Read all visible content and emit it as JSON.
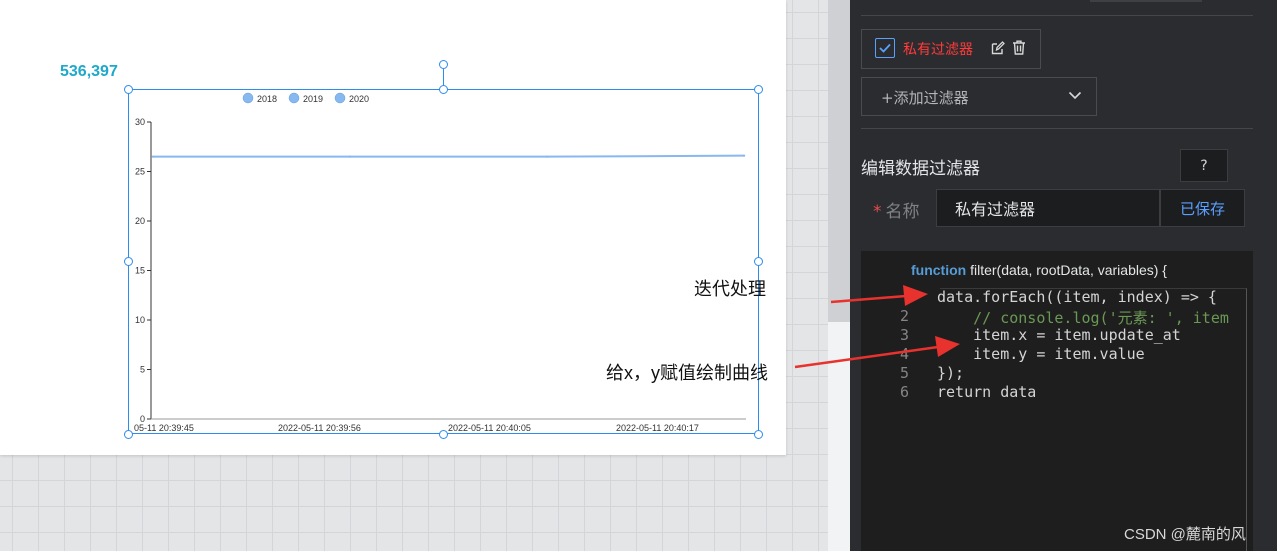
{
  "canvas": {
    "counter_value": "536,397",
    "chart_legend": [
      "2018",
      "2019",
      "2020"
    ]
  },
  "chart_data": {
    "type": "line",
    "x": [
      "05-11 20:39:45",
      "2022-05-11 20:39:56",
      "2022-05-11 20:40:05",
      "2022-05-11 20:40:17"
    ],
    "series": [
      {
        "name": "2018",
        "values": [
          26.5,
          26.5,
          26.5,
          26.6
        ]
      }
    ],
    "y_ticks": [
      0,
      5,
      10,
      15,
      20,
      25,
      30
    ],
    "ylim": [
      0,
      30
    ],
    "legend": [
      "2018",
      "2019",
      "2020"
    ],
    "legend_position": "top-left",
    "grid": false,
    "line_color": "#88b8f0"
  },
  "annotations": {
    "iterate": "迭代处理",
    "assign": "给x，y赋值绘制曲线"
  },
  "panel": {
    "filter_chip_label": "私有过滤器",
    "add_filter_label": "+添加过滤器",
    "edit_title": "编辑数据过滤器",
    "help_label": "?",
    "name_required_mark": "*",
    "name_label": "名称",
    "name_value": "私有过滤器",
    "save_label": "已保存"
  },
  "editor": {
    "signature_keyword": "function",
    "signature_rest": " filter(data, rootData, variables) {",
    "lines": [
      {
        "num": "",
        "text": "data.forEach((item, index) => {"
      },
      {
        "num": "2",
        "text": "    // console.log('元素: ', item"
      },
      {
        "num": "3",
        "text": "    item.x = item.update_at"
      },
      {
        "num": "4",
        "text": "    item.y = item.value"
      },
      {
        "num": "5",
        "text": "});"
      },
      {
        "num": "6",
        "text": "return data"
      }
    ]
  },
  "watermark": "CSDN @麓南的风",
  "colors": {
    "accent": "#2d8cf0",
    "counter": "#1fa8c9",
    "panel_bg": "#2b2c2f",
    "editor_bg": "#1e1e1e",
    "annotation_arrow": "#e8322e",
    "chip_text": "#ff3b3b",
    "save_text": "#5aa0ff"
  },
  "icons": {
    "check": "check-icon",
    "edit": "edit-icon",
    "trash": "trash-icon",
    "chevron": "chevron-down-icon"
  }
}
